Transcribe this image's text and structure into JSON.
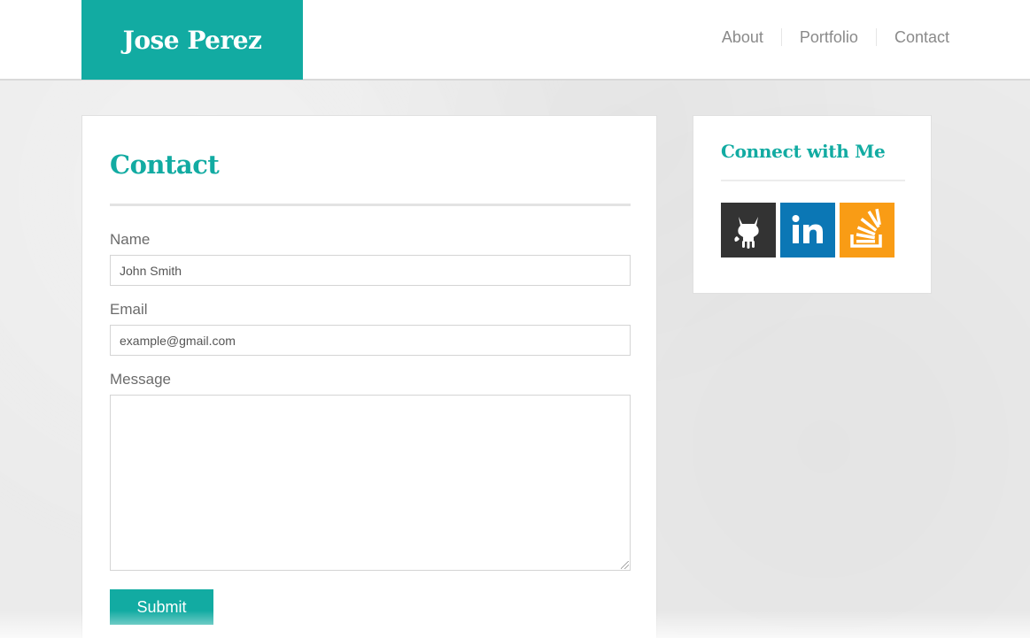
{
  "header": {
    "brand": "Jose Perez",
    "nav": [
      {
        "label": "About"
      },
      {
        "label": "Portfolio"
      },
      {
        "label": "Contact"
      }
    ]
  },
  "contact": {
    "title": "Contact",
    "name_label": "Name",
    "name_placeholder": "John Smith",
    "email_label": "Email",
    "email_placeholder": "example@gmail.com",
    "message_label": "Message",
    "message_value": "",
    "submit_label": "Submit"
  },
  "sidebar": {
    "title": "Connect with Me",
    "social": [
      {
        "icon": "github-icon",
        "color": "#333333"
      },
      {
        "icon": "linkedin-icon",
        "color": "#0b77b5"
      },
      {
        "icon": "stackoverflow-icon",
        "color": "#f99c15"
      }
    ]
  },
  "colors": {
    "accent": "#12aba2",
    "background": "#ebebeb"
  }
}
